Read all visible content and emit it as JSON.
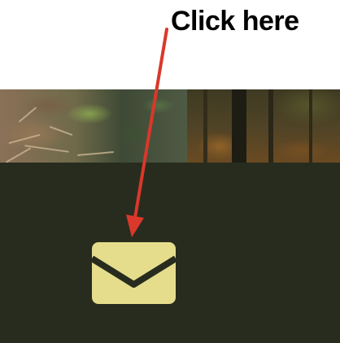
{
  "annotation": {
    "label": "Click here",
    "arrow_color": "#d9382b"
  },
  "mail_button": {
    "icon": "envelope-icon",
    "color": "#e5dd8c"
  },
  "colors": {
    "panel_background": "#282c1e",
    "page_background": "#ffffff"
  }
}
